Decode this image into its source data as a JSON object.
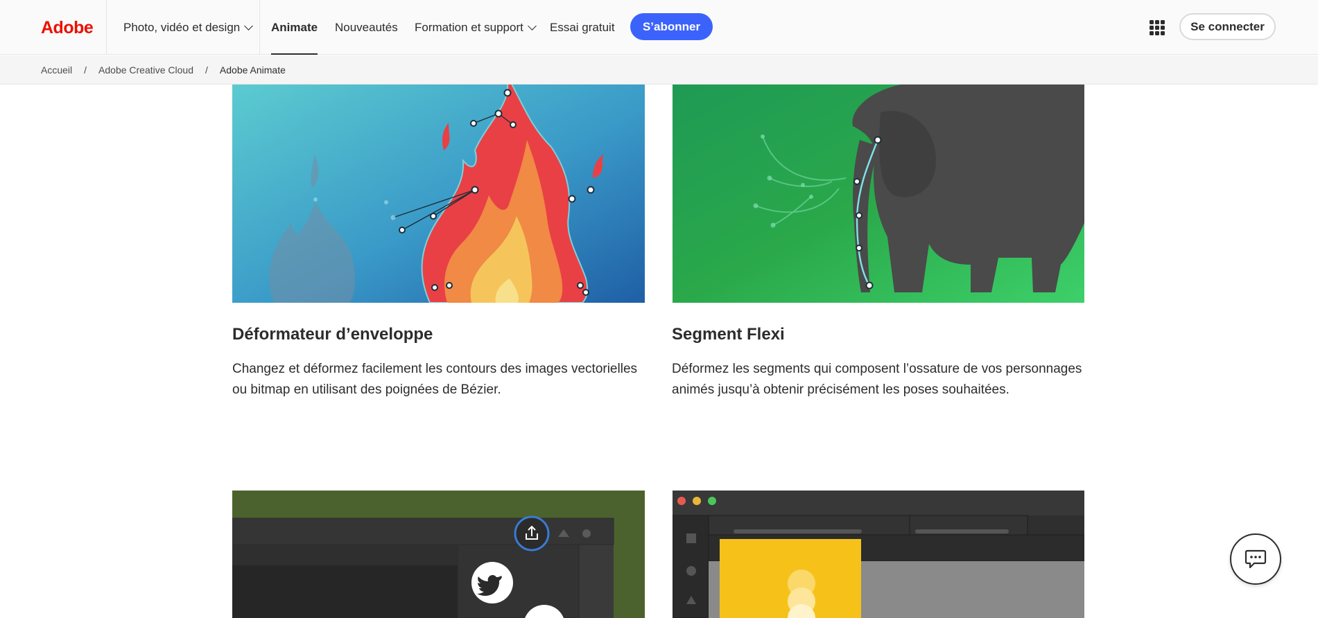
{
  "header": {
    "logo": "Adobe",
    "nav": [
      {
        "label": "Photo, vidéo et design",
        "has_dropdown": true
      },
      {
        "label": "Animate",
        "active": true
      },
      {
        "label": "Nouveautés"
      },
      {
        "label": "Formation et support",
        "has_dropdown": true
      },
      {
        "label": "Essai gratuit"
      }
    ],
    "subscribe_label": "S’abonner",
    "apps_icon": "app-switcher-grid-icon",
    "signin_label": "Se connecter"
  },
  "breadcrumb": [
    "Accueil",
    "Adobe Creative Cloud",
    "Adobe Animate"
  ],
  "cards": [
    {
      "title": "Déformateur d’enveloppe",
      "description": "Changez et déformez facilement les contours des images vectorielles ou bitmap en utilisant des poignées de Bézier.",
      "image": "flame-bezier-illustration"
    },
    {
      "title": "Segment Flexi",
      "description": "Déformez les segments qui composent l’ossature de vos personnages animés jusqu’à obtenir précisément les poses souhaitées.",
      "image": "elephant-trunk-illustration"
    },
    {
      "title": "",
      "description": "",
      "image": "share-panel-twitter-illustration"
    },
    {
      "title": "",
      "description": "",
      "image": "app-window-yellow-panel-illustration"
    }
  ],
  "chat": {
    "icon": "chat-bubble-icon"
  },
  "colors": {
    "brand": "#eb1000",
    "accent": "#3b63fb",
    "text": "#2c2c2c"
  }
}
